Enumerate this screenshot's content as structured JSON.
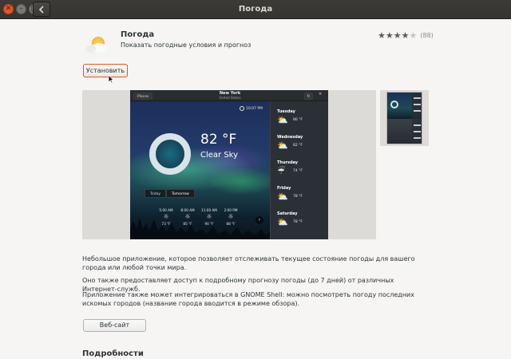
{
  "window": {
    "title": "Погода"
  },
  "app": {
    "name": "Погода",
    "summary": "Показать погодные условия и прогноз",
    "rating_stars": 4,
    "rating_max": 5,
    "rating_count": "(88)",
    "install_label": "Установить"
  },
  "screenshot": {
    "places_label": "Places",
    "city": "New York",
    "country": "United States",
    "time": "10:07 PM",
    "temperature": "82 °F",
    "condition": "Clear Sky",
    "tabs": [
      "Today",
      "Tomorrow"
    ],
    "active_tab": "Tomorrow",
    "hourly": [
      {
        "time": "5:00 AM",
        "icon": "sun-icon",
        "temp": "73 °F"
      },
      {
        "time": "8:00 AM",
        "icon": "sun-icon",
        "temp": "85 °F"
      },
      {
        "time": "11:00 AM",
        "icon": "sun-icon",
        "temp": "90 °F"
      },
      {
        "time": "2:00 PM",
        "icon": "sun-icon",
        "temp": "88 °F"
      }
    ],
    "forecast": [
      {
        "day": "Tuesday",
        "icon": "sun-cloud-icon",
        "temp": "86 °F"
      },
      {
        "day": "Wednesday",
        "icon": "sun-cloud-icon",
        "temp": "82 °F"
      },
      {
        "day": "Thursday",
        "icon": "rain-icon",
        "temp": "74 °F"
      },
      {
        "day": "Friday",
        "icon": "sun-cloud-icon",
        "temp": "78 °F"
      },
      {
        "day": "Saturday",
        "icon": "sun-cloud-icon",
        "temp": "78 °F"
      }
    ]
  },
  "description": {
    "p1": "Небольшое приложение, которое позволяет отслеживать текущее состояние погоды для вашего города или любой точки мира.",
    "p2": "Оно также предоставляет доступ к подробному прогнозу погоды (до 7 дней) от различных Интернет-служб.",
    "p3": "Приложение также может интегрироваться в GNOME Shell: можно посмотреть погоду последних искомых городов (название города вводится в режиме обзора)."
  },
  "website_label": "Веб-сайт",
  "details_heading": "Подробности",
  "colors": {
    "accent": "#e95420",
    "titlebar": "#3c3b37",
    "background": "#f6f5f4"
  }
}
